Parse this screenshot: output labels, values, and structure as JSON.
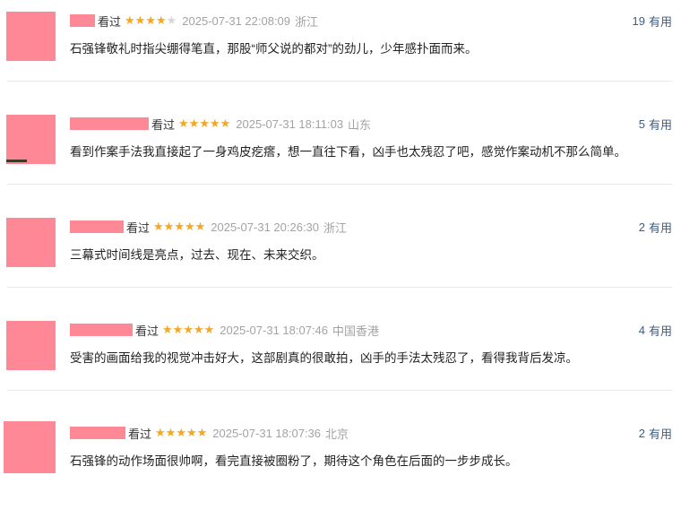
{
  "reviews": [
    {
      "username": "",
      "watched_label": "看过",
      "rating": 4,
      "time": "2025-07-31 22:08:09",
      "location": "浙江",
      "useful_count": "19",
      "useful_label": "有用",
      "content": "石强锋敬礼时指尖绷得笔直，那股“师父说的都对”的劲儿，少年感扑面而来。"
    },
    {
      "username": "",
      "watched_label": "看过",
      "rating": 5,
      "time": "2025-07-31 18:11:03",
      "location": "山东",
      "useful_count": "5",
      "useful_label": "有用",
      "content": "看到作案手法我直接起了一身鸡皮疙瘩，想一直往下看，凶手也太残忍了吧，感觉作案动机不那么简单。"
    },
    {
      "username": "",
      "watched_label": "看过",
      "rating": 5,
      "time": "2025-07-31 20:26:30",
      "location": "浙江",
      "useful_count": "2",
      "useful_label": "有用",
      "content": "三幕式时间线是亮点，过去、现在、未来交织。"
    },
    {
      "username": "",
      "watched_label": "看过",
      "rating": 5,
      "time": "2025-07-31 18:07:46",
      "location": "中国香港",
      "useful_count": "4",
      "useful_label": "有用",
      "content": "受害的画面给我的视觉冲击好大，这部剧真的很敢拍，凶手的手法太残忍了，看得我背后发凉。"
    },
    {
      "username": "",
      "watched_label": "看过",
      "rating": 5,
      "time": "2025-07-31 18:07:36",
      "location": "北京",
      "useful_count": "2",
      "useful_label": "有用",
      "content": "石强锋的动作场面很帅啊，看完直接被圈粉了，期待这个角色在后面的一步步成长。"
    }
  ],
  "colors": {
    "star": "#f5a623",
    "star_off": "#d6d6d6",
    "useful": "#3e5d82",
    "redaction": "#ff8896"
  }
}
